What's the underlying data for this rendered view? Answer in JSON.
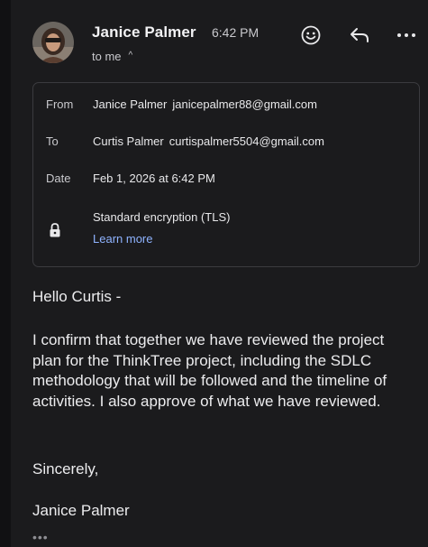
{
  "sender": {
    "name": "Janice Palmer",
    "time": "6:42 PM",
    "recipient_summary": "to me"
  },
  "header_icons": [
    "smiley-icon",
    "reply-icon",
    "more-icon"
  ],
  "details": {
    "from_label": "From",
    "from_name": "Janice Palmer",
    "from_email": "janicepalmer88@gmail.com",
    "to_label": "To",
    "to_name": "Curtis Palmer",
    "to_email": "curtispalmer5504@gmail.com",
    "date_label": "Date",
    "date_value": "Feb 1, 2026 at 6:42 PM",
    "encryption": "Standard encryption (TLS)",
    "learn_more": "Learn more"
  },
  "message": {
    "greeting": "Hello Curtis -",
    "paragraph": "I confirm that together we have reviewed the project plan for the ThinkTree project, including the SDLC methodology that will be followed and the timeline of activities.  I also approve of what we have reviewed.",
    "closing": "Sincerely,",
    "signature": "Janice Palmer"
  },
  "colors": {
    "background": "#1b1b1d",
    "text": "#e8e8ea",
    "secondary_text": "#c9c9cd",
    "link": "#8fb3ff",
    "card_border": "#3b3b3f"
  }
}
